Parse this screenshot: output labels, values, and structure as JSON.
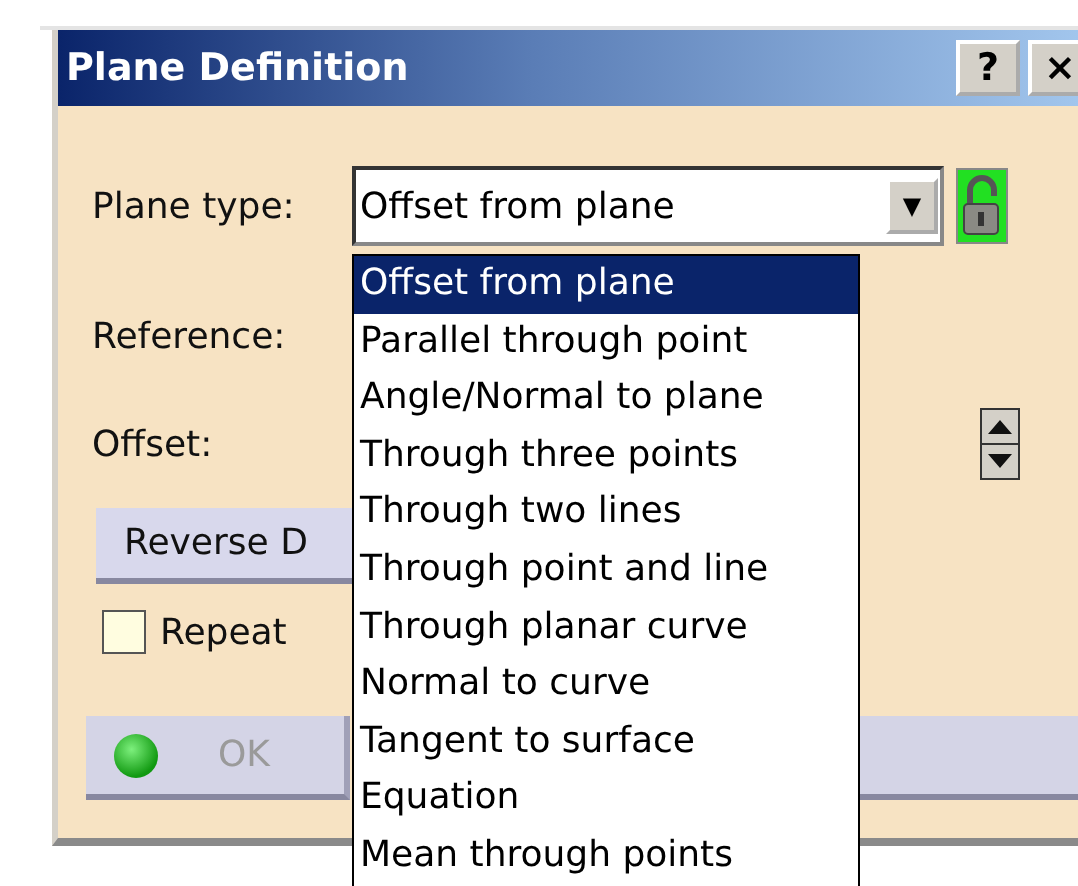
{
  "window": {
    "title": "Plane Definition",
    "buttons": [
      "?",
      "×"
    ]
  },
  "plane_type": {
    "label": "Plane type:",
    "value": "Offset from plane",
    "arrow": "▼"
  },
  "dropdown": {
    "items": [
      {
        "label": "Offset from plane",
        "selected": true
      },
      {
        "label": "Parallel through point",
        "selected": false
      },
      {
        "label": "Angle/Normal to plane",
        "selected": false
      },
      {
        "label": "Through three points",
        "selected": false
      },
      {
        "label": "Through two lines",
        "selected": false
      },
      {
        "label": "Through point and line",
        "selected": false
      },
      {
        "label": "Through planar curve",
        "selected": false
      },
      {
        "label": "Normal to curve",
        "selected": false
      },
      {
        "label": "Tangent to surface",
        "selected": false
      },
      {
        "label": "Equation",
        "selected": false
      },
      {
        "label": "Mean through points",
        "selected": false
      }
    ]
  },
  "reference": {
    "label": "Reference:"
  },
  "offset": {
    "label": "Offset:"
  },
  "reverse_button": {
    "label": "Reverse D"
  },
  "repeat": {
    "label": "Repeat",
    "checked": false
  },
  "ok_button": {
    "label": "OK",
    "disabled": true
  }
}
